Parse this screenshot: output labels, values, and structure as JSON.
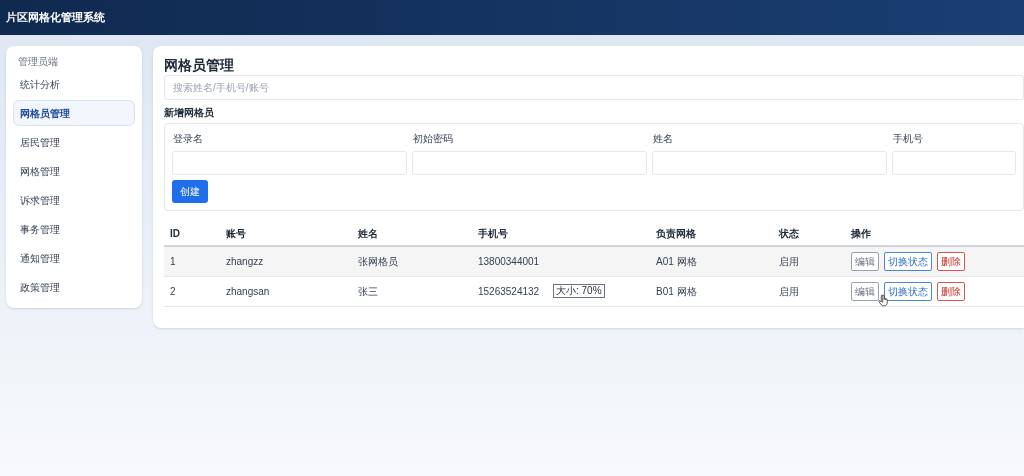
{
  "header": {
    "title": "片区网格化管理系统"
  },
  "sidebar": {
    "heading": "管理员端",
    "items": [
      {
        "label": "统计分析",
        "selected": false
      },
      {
        "label": "网格员管理",
        "selected": true
      },
      {
        "label": "居民管理",
        "selected": false
      },
      {
        "label": "网格管理",
        "selected": false
      },
      {
        "label": "诉求管理",
        "selected": false
      },
      {
        "label": "事务管理",
        "selected": false
      },
      {
        "label": "通知管理",
        "selected": false
      },
      {
        "label": "政策管理",
        "selected": false
      }
    ]
  },
  "main": {
    "title": "网格员管理",
    "search": {
      "placeholder": "搜索姓名/手机号/账号"
    },
    "form": {
      "title": "新增网格员",
      "fields": [
        {
          "label": "登录名"
        },
        {
          "label": "初始密码"
        },
        {
          "label": "姓名"
        },
        {
          "label": "手机号"
        }
      ],
      "submit": "创建"
    },
    "table": {
      "columns": [
        "ID",
        "账号",
        "姓名",
        "手机号",
        "负责网格",
        "状态",
        "操作"
      ],
      "rows": [
        {
          "cells": [
            "1",
            "zhangzz",
            "张网格员",
            "13800344001",
            "A01 网格",
            "启用"
          ],
          "actions": [
            "编辑",
            "切换状态",
            "删除"
          ]
        },
        {
          "cells": [
            "2",
            "zhangsan",
            "张三",
            "15263524132",
            "B01 网格",
            "启用"
          ],
          "actions": [
            "编辑",
            "切换状态",
            "删除"
          ]
        }
      ]
    },
    "tooltip": "大小: 70%"
  }
}
